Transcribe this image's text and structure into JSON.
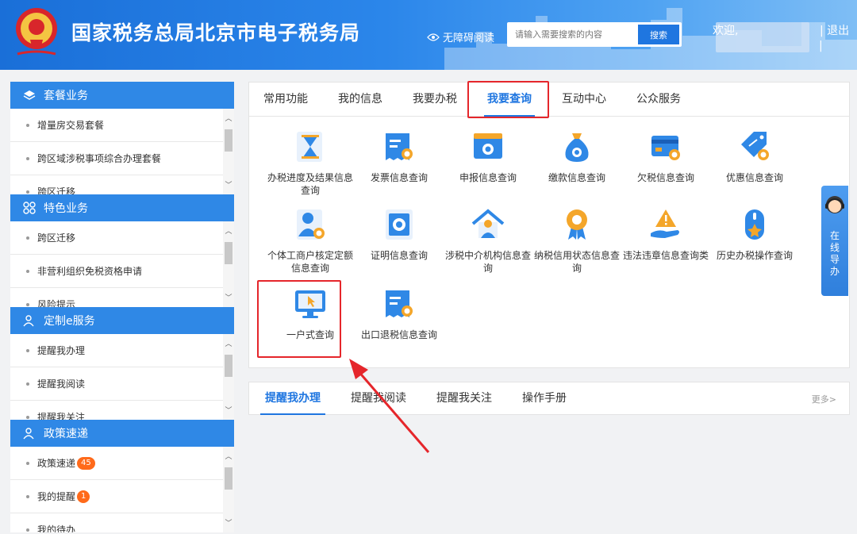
{
  "header": {
    "title": "国家税务总局北京市电子税务局",
    "accessibility": "无障碍阅读",
    "search_placeholder": "请输入需要搜索的内容",
    "search_button": "搜索",
    "welcome": "欢迎,",
    "logout": "退出",
    "separator": "|"
  },
  "sidebar": {
    "sections": [
      {
        "title": "套餐业务",
        "icon": "layers-icon",
        "items": [
          "增量房交易套餐",
          "跨区域涉税事项综合办理套餐",
          "跨区迁移"
        ]
      },
      {
        "title": "特色业务",
        "icon": "grid-circles-icon",
        "items": [
          "跨区迁移",
          "非营利组织免税资格申请",
          "风险提示"
        ]
      },
      {
        "title": "定制e服务",
        "icon": "user-icon",
        "items": [
          "提醒我办理",
          "提醒我阅读",
          "提醒我关注"
        ]
      },
      {
        "title": "政策速递",
        "icon": "user-icon",
        "items": [
          {
            "label": "政策速递",
            "badge": "45"
          },
          {
            "label": "我的提醒",
            "badge": "1"
          },
          {
            "label": "我的待办",
            "badge": ""
          }
        ]
      }
    ]
  },
  "main": {
    "tabs": [
      "常用功能",
      "我的信息",
      "我要办税",
      "我要查询",
      "互动中心",
      "公众服务"
    ],
    "active_tab": "我要查询",
    "tiles": [
      {
        "label": "办税进度及结果信息查询",
        "icon": "hourglass-doc-icon"
      },
      {
        "label": "发票信息查询",
        "icon": "invoice-search-icon"
      },
      {
        "label": "申报信息查询",
        "icon": "report-search-icon"
      },
      {
        "label": "缴款信息查询",
        "icon": "money-bag-icon"
      },
      {
        "label": "欠税信息查询",
        "icon": "card-search-icon"
      },
      {
        "label": "优惠信息查询",
        "icon": "discount-tag-icon"
      },
      {
        "label": "个体工商户核定定额信息查询",
        "icon": "person-search-icon"
      },
      {
        "label": "证明信息查询",
        "icon": "certificate-search-icon"
      },
      {
        "label": "涉税中介机构信息查询",
        "icon": "agency-house-icon"
      },
      {
        "label": "纳税信用状态信息查询",
        "icon": "credit-medal-icon"
      },
      {
        "label": "违法违章信息查询类",
        "icon": "warning-hand-icon"
      },
      {
        "label": "历史办税操作查询",
        "icon": "history-mouse-icon"
      },
      {
        "label": "一户式查询",
        "icon": "monitor-cursor-icon"
      },
      {
        "label": "出口退税信息查询",
        "icon": "export-refund-icon"
      }
    ]
  },
  "bottom": {
    "tabs": [
      "提醒我办理",
      "提醒我阅读",
      "提醒我关注",
      "操作手册"
    ],
    "more": "更多>"
  },
  "guide": {
    "label": "在线导办"
  },
  "colors": {
    "primary": "#1f76e0",
    "header": "#2b86ea",
    "highlight": "#e5262b",
    "badge": "#ff6a1a"
  }
}
